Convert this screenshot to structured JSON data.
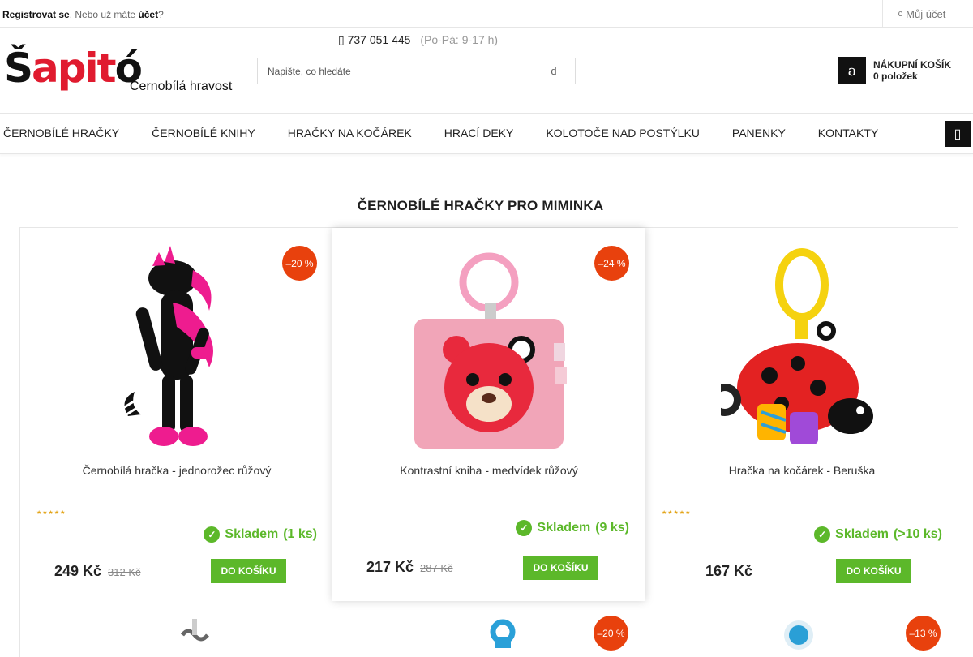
{
  "topbar": {
    "register_label": "Registrovat se",
    "already_text": ". Nebo už máte ",
    "account_word": "účet",
    "question_mark": "?",
    "my_account_icon": "user-icon",
    "my_account_label": "Můj účet"
  },
  "header": {
    "phone_icon": "phone-icon",
    "phone": "737 051 445",
    "hours": "(Po-Pá: 9-17 h)",
    "logo_text_pre": "Š",
    "logo_text_accent": "apit",
    "logo_text_post": "ó",
    "tagline": "Černobílá hravost",
    "search_placeholder": "Napište, co hledáte",
    "search_icon": "search-icon",
    "cart_title": "NÁKUPNÍ KOŠÍK",
    "cart_count": "0 položek"
  },
  "nav": {
    "items": [
      {
        "label": "ČERNOBÍLÉ HRAČKY"
      },
      {
        "label": "ČERNOBÍLÉ KNIHY"
      },
      {
        "label": "HRAČKY NA KOČÁREK"
      },
      {
        "label": "HRACÍ DEKY"
      },
      {
        "label": "KOLOTOČE NAD POSTÝLKU"
      },
      {
        "label": "PANENKY"
      },
      {
        "label": "KONTAKTY"
      }
    ],
    "menu_icon": "menu-icon"
  },
  "section_title": "ČERNOBÍLÉ HRAČKY PRO MIMINKA",
  "products": [
    {
      "discount": "–20 %",
      "name": "Černobílá hračka - jednorožec růžový",
      "rating": "★★★★★",
      "stock_label": "Skladem",
      "stock_qty": "(1 ks)",
      "price": "249 Kč",
      "old_price": "312 Kč",
      "buy_label": "DO KOŠÍKU",
      "image": "unicorn-toy"
    },
    {
      "discount": "–24 %",
      "name": "Kontrastní kniha - medvídek růžový",
      "rating": "",
      "stock_label": "Skladem",
      "stock_qty": "(9 ks)",
      "price": "217 Kč",
      "old_price": "287 Kč",
      "buy_label": "DO KOŠÍKU",
      "image": "bear-book"
    },
    {
      "discount": "",
      "name": "Hračka na kočárek - Beruška",
      "rating": "★★★★★",
      "stock_label": "Skladem",
      "stock_qty": "(>10 ks)",
      "price": "167 Kč",
      "old_price": "",
      "buy_label": "DO KOŠÍKU",
      "image": "ladybug-toy"
    }
  ],
  "next_row_badges": [
    "–20 %",
    "–13 %"
  ],
  "colors": {
    "accent_green": "#5cb82a",
    "discount_orange": "#e8410d",
    "logo_red": "#e01b2f"
  }
}
